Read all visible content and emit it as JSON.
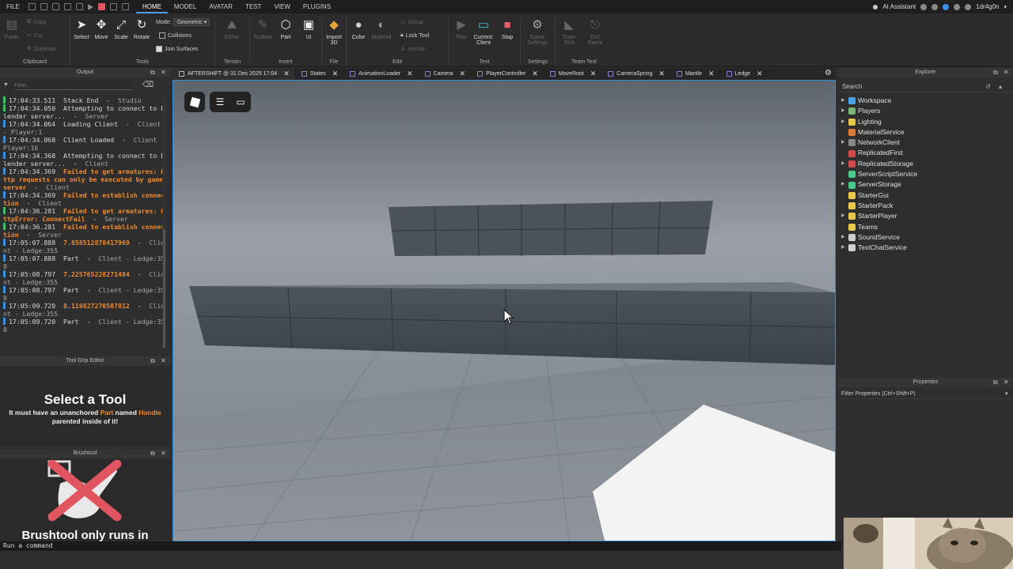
{
  "menubar": {
    "file": "FILE",
    "tabs": [
      "HOME",
      "MODEL",
      "AVATAR",
      "TEST",
      "VIEW",
      "PLUGINS"
    ],
    "active_tab": "HOME",
    "ai_assistant": "AI Assistant",
    "username": "1dr4g0n"
  },
  "ribbon": {
    "clipboard": {
      "paste": "Paste",
      "copy": "Copy",
      "cut": "Cut",
      "duplicate": "Duplicate",
      "label": "Clipboard"
    },
    "tools": {
      "select": "Select",
      "move": "Move",
      "scale": "Scale",
      "rotate": "Rotate",
      "mode_label": "Mode:",
      "mode_value": "Geometric",
      "collisions": "Collisions",
      "join_surfaces": "Join Surfaces",
      "label": "Tools"
    },
    "terrain": {
      "editor": "Editor",
      "label": "Terrain"
    },
    "insert": {
      "toolbox": "Toolbox",
      "part": "Part",
      "ui": "UI",
      "label": "Insert"
    },
    "file": {
      "import3d_line1": "Import",
      "import3d_line2": "3D",
      "label": "File"
    },
    "edit": {
      "color": "Color",
      "material": "Material",
      "group": "Group",
      "lock_tool": "Lock Tool",
      "anchor": "Anchor",
      "label": "Edit"
    },
    "test": {
      "play": "Play",
      "current_line1": "Current:",
      "current_line2": "Client",
      "stop": "Stop",
      "label": "Test"
    },
    "settings": {
      "game_settings_line1": "Game",
      "game_settings_line2": "Settings",
      "label": "Settings"
    },
    "team_test": {
      "team_test_line1": "Team",
      "team_test_line2": "Test",
      "exit_game_line1": "Exit",
      "exit_game_line2": "Game",
      "label": "Team Test"
    }
  },
  "output": {
    "title": "Output",
    "filter_placeholder": "Filter...",
    "lines": [
      {
        "ts": "17:04:33.511",
        "msg": "Stack End",
        "src": "Studio",
        "kind": "info",
        "color": "#3fbf5a"
      },
      {
        "ts": "17:04:34.050",
        "msg": "Attempting to connect to Blender server...",
        "src": "Server",
        "kind": "info",
        "color": "#3fbf5a"
      },
      {
        "ts": "17:04:34.064",
        "msg": "Loading Client",
        "src": "Client - Player:1",
        "kind": "info",
        "color": "#3b8fe0"
      },
      {
        "ts": "17:04:34.068",
        "msg": "Client Loaded",
        "src": "Client - Player:16",
        "kind": "info",
        "color": "#3b8fe0"
      },
      {
        "ts": "17:04:34.368",
        "msg": "Attempting to connect to Blender server...",
        "src": "Client",
        "kind": "info",
        "color": "#3b8fe0"
      },
      {
        "ts": "17:04:34.369",
        "msg": "Failed to get armatures: Http requests can only be executed by game server",
        "src": "Client",
        "kind": "err",
        "color": "#3b8fe0"
      },
      {
        "ts": "17:04:34.369",
        "msg": "Failed to establish connection",
        "src": "Client",
        "kind": "err",
        "color": "#3b8fe0"
      },
      {
        "ts": "17:04:36.281",
        "msg": "Failed to get armatures: HttpError: ConnectFail",
        "src": "Server",
        "kind": "err",
        "color": "#3fbf5a"
      },
      {
        "ts": "17:04:36.281",
        "msg": "Failed to establish connection",
        "src": "Server",
        "kind": "err",
        "color": "#3fbf5a"
      },
      {
        "ts": "17:05:07.888",
        "msg": "7.858512878417969",
        "src": "Client - Ledge:355",
        "kind": "err",
        "color": "#3b8fe0"
      },
      {
        "ts": "17:05:07.888",
        "msg": "Part",
        "src": "Client - Ledge:358",
        "kind": "info",
        "color": "#3b8fe0"
      },
      {
        "ts": "17:05:08.797",
        "msg": "7.225765228271484",
        "src": "Client - Ledge:355",
        "kind": "err",
        "color": "#3b8fe0"
      },
      {
        "ts": "17:05:08.797",
        "msg": "Part",
        "src": "Client - Ledge:358",
        "kind": "info",
        "color": "#3b8fe0"
      },
      {
        "ts": "17:05:09.720",
        "msg": "8.119827270507812",
        "src": "Client - Ledge:355",
        "kind": "err",
        "color": "#3b8fe0"
      },
      {
        "ts": "17:05:09.720",
        "msg": "Part",
        "src": "Client - Ledge:358",
        "kind": "info",
        "color": "#3b8fe0"
      }
    ]
  },
  "toolgrip": {
    "title": "Tool Grip Editor",
    "heading": "Select a Tool",
    "sub_prefix": "It must have an unanchored ",
    "sub_part": "Part",
    "sub_mid": " named ",
    "sub_handle": "Handle",
    "sub_suffix": "parented inside of it!"
  },
  "brushtool": {
    "title": "Brushtool",
    "message": "Brushtool only runs in"
  },
  "viewport_tabs": [
    {
      "label": "AFTERSHIFT @ 31 Dec 2025 17:04",
      "active": true
    },
    {
      "label": "States"
    },
    {
      "label": "AnimationLoader"
    },
    {
      "label": "Camera"
    },
    {
      "label": "PlayerController"
    },
    {
      "label": "MoveRoot"
    },
    {
      "label": "CameraSpring"
    },
    {
      "label": "Mantle"
    },
    {
      "label": "Ledge"
    }
  ],
  "explorer": {
    "title": "Explorer",
    "search_placeholder": "Search",
    "items": [
      {
        "label": "Workspace",
        "expand": true,
        "color": "#4aa3e6"
      },
      {
        "label": "Players",
        "expand": true,
        "color": "#7ab87a"
      },
      {
        "label": "Lighting",
        "expand": true,
        "color": "#e8c84a"
      },
      {
        "label": "MaterialService",
        "expand": false,
        "color": "#e07a3a"
      },
      {
        "label": "NetworkClient",
        "expand": true,
        "color": "#888888"
      },
      {
        "label": "ReplicatedFirst",
        "expand": false,
        "color": "#d04a4a"
      },
      {
        "label": "ReplicatedStorage",
        "expand": true,
        "color": "#d04a4a"
      },
      {
        "label": "ServerScriptService",
        "expand": false,
        "color": "#4ac88a"
      },
      {
        "label": "ServerStorage",
        "expand": true,
        "color": "#4ac88a"
      },
      {
        "label": "StarterGui",
        "expand": false,
        "color": "#e8c84a"
      },
      {
        "label": "StarterPack",
        "expand": false,
        "color": "#e8c84a"
      },
      {
        "label": "StarterPlayer",
        "expand": true,
        "color": "#e8c84a"
      },
      {
        "label": "Teams",
        "expand": false,
        "color": "#e8c84a"
      },
      {
        "label": "SoundService",
        "expand": true,
        "color": "#cfcfcf"
      },
      {
        "label": "TextChatService",
        "expand": true,
        "color": "#cfcfcf"
      }
    ]
  },
  "properties": {
    "title": "Properties",
    "filter_placeholder": "Filter Properties (Ctrl+Shift+P)"
  },
  "command_bar": {
    "placeholder": "Run a command"
  }
}
